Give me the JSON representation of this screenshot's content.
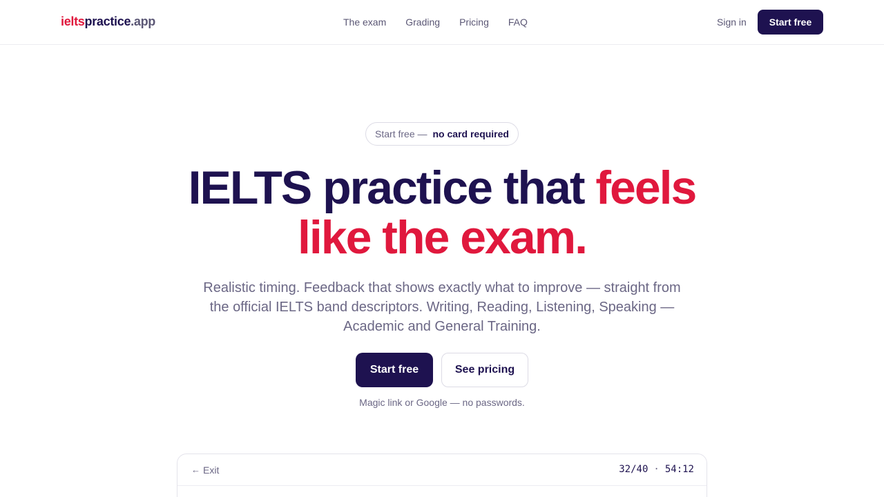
{
  "header": {
    "logo": {
      "part1": "ielts",
      "part2": "practice",
      "part3": ".app"
    },
    "nav": [
      {
        "label": "The exam"
      },
      {
        "label": "Grading"
      },
      {
        "label": "Pricing"
      },
      {
        "label": "FAQ"
      }
    ],
    "sign_in": "Sign in",
    "start_free": "Start free"
  },
  "hero": {
    "pill": {
      "lead": "Start free —",
      "emphasis": "no card required"
    },
    "headline": {
      "line1_dark": "IELTS practice that ",
      "line1_red": "feels",
      "line2_red": "like the exam."
    },
    "subtitle": "Realistic timing. Feedback that shows exactly what to improve — straight from the official IELTS band descriptors. Writing, Reading, Listening, Speaking — Academic and General Training.",
    "cta_primary": "Start free",
    "cta_secondary": "See pricing",
    "note": "Magic link or Google — no passwords."
  },
  "preview": {
    "exit_label": "Exit",
    "progress": "32/40",
    "separator": "·",
    "timer": "54:12"
  },
  "colors": {
    "brand_dark": "#1e1250",
    "accent_red": "#e0183d",
    "muted_text": "#6b6785"
  }
}
